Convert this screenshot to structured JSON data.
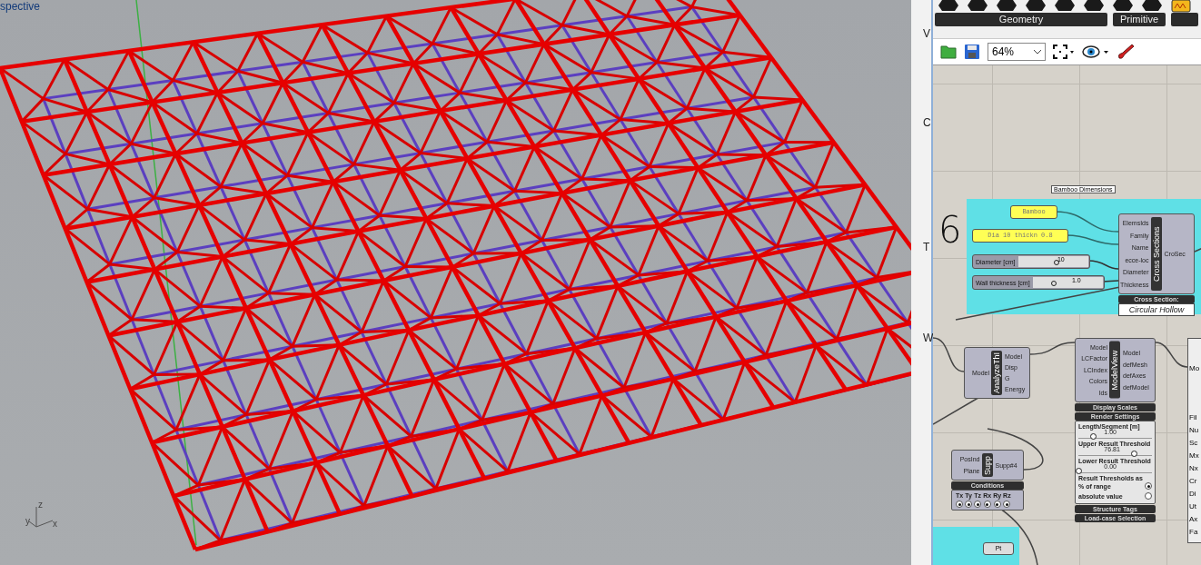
{
  "viewport": {
    "label": "spective",
    "axes": [
      {
        "label": "z"
      },
      {
        "label": "y"
      },
      {
        "label": "x"
      }
    ]
  },
  "side_panel": {
    "letters": [
      "V",
      "C",
      "T",
      "W"
    ]
  },
  "ribbon": {
    "groups": [
      {
        "label": "Geometry"
      },
      {
        "label": "Primitive"
      }
    ]
  },
  "toolbar": {
    "zoom": "64%"
  },
  "canvas": {
    "annotation": "6",
    "group_label": "Bamboo Dimensions",
    "panels": [
      {
        "text": "Bamboo"
      },
      {
        "text": "Dia 10 thickn 0.8"
      }
    ],
    "sliders": [
      {
        "label": "Diameter [cm]",
        "value": "10",
        "level": 0.55
      },
      {
        "label": "Wall thickness [cm]",
        "value": "1.0",
        "level": 0.3
      }
    ],
    "components": [
      {
        "title": "Cross Sections",
        "inputs": [
          "ElemsIds",
          "Family",
          "Name",
          "ecce-loc",
          "Diameter",
          "Thickness"
        ],
        "outputs": [
          "CroSec"
        ],
        "sections": [
          {
            "kind": "dropdown",
            "label": "Cross Section:",
            "value": "Circular Hollow"
          }
        ]
      },
      {
        "title": "AnalyzeThI",
        "inputs": [
          "Model"
        ],
        "outputs": [
          "Model",
          "Disp",
          "G",
          "Energy"
        ]
      },
      {
        "title": "ModelView",
        "inputs": [
          "Model",
          "LCFactor",
          "LCIndex",
          "Colors",
          "Ids"
        ],
        "outputs": [
          "Model",
          "defMesh",
          "defAxes",
          "defModel"
        ],
        "sections": [
          {
            "kind": "header",
            "label": "Display Scales"
          },
          {
            "kind": "header",
            "label": "Render Settings"
          },
          {
            "kind": "settings",
            "sliders": [
              {
                "label": "Length/Segment [m]",
                "value": "1.00",
                "level": 0.2
              },
              {
                "label": "Upper Result Threshold",
                "value": "76.81",
                "level": 0.75
              },
              {
                "label": "Lower Result Threshold",
                "value": "0.00",
                "level": 0
              }
            ],
            "caption": "Result Thresholds as",
            "options": [
              {
                "label": "% of range",
                "selected": true
              },
              {
                "label": "absolute value",
                "selected": false
              }
            ]
          },
          {
            "kind": "header",
            "label": "Structure Tags"
          },
          {
            "kind": "header",
            "label": "Load-case Selection"
          }
        ]
      },
      {
        "title": "Supp",
        "inputs": [
          "PosInd",
          "Plane"
        ],
        "outputs": [
          "Supp#4"
        ],
        "sections": [
          {
            "kind": "header",
            "label": "Conditions"
          },
          {
            "kind": "dofs",
            "items": [
              {
                "label": "Tx",
                "checked": true
              },
              {
                "label": "Ty",
                "checked": true
              },
              {
                "label": "Tz",
                "checked": true
              },
              {
                "label": "Rx",
                "checked": true
              },
              {
                "label": "Ry",
                "checked": true
              },
              {
                "label": "Rz",
                "checked": true
              }
            ]
          }
        ]
      }
    ],
    "partial_component": {
      "input": "Mo",
      "rows": [
        "Fil",
        "Nu",
        "Sc",
        "Mx",
        "Nx",
        "Cr",
        "Di",
        "Ut",
        "Ax",
        "Fa"
      ]
    },
    "point_node": "Pt"
  }
}
